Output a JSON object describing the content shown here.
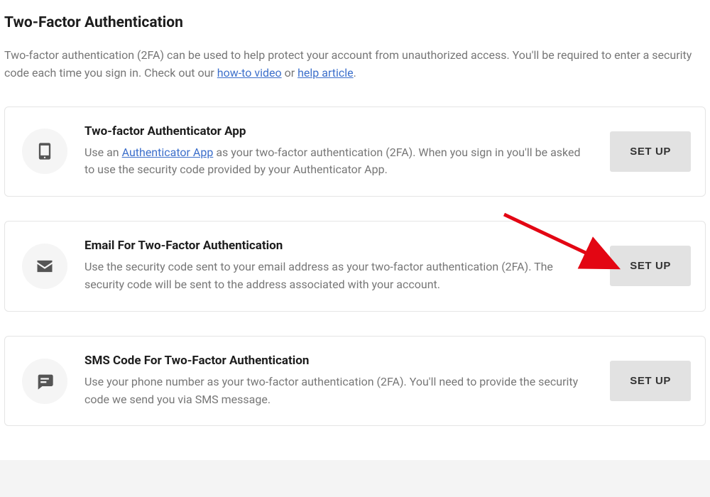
{
  "title": "Two-Factor Authentication",
  "intro": {
    "prefix": "Two-factor authentication (2FA) can be used to help protect your account from unauthorized access. You'll be required to enter a security code each time you sign in. Check out our ",
    "link1": "how-to video",
    "mid": " or ",
    "link2": "help article",
    "suffix": "."
  },
  "cards": {
    "app": {
      "title": "Two-factor Authenticator App",
      "desc_prefix": "Use an ",
      "desc_link": "Authenticator App",
      "desc_suffix": " as your two-factor authentication (2FA). When you sign in you'll be asked to use the security code provided by your Authenticator App.",
      "button": "SET UP"
    },
    "email": {
      "title": "Email For Two-Factor Authentication",
      "desc": "Use the security code sent to your email address as your two-factor authentication (2FA). The security code will be sent to the address associated with your account.",
      "button": "SET UP"
    },
    "sms": {
      "title": "SMS Code For Two-Factor Authentication",
      "desc": "Use your phone number as your two-factor authentication (2FA). You'll need to provide the security code we send you via SMS message.",
      "button": "SET UP"
    }
  }
}
